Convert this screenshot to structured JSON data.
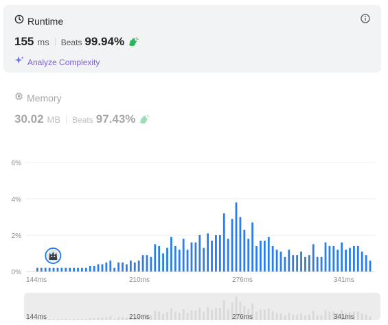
{
  "runtime": {
    "title": "Runtime",
    "value": "155",
    "unit": "ms",
    "beats_label": "Beats",
    "beats_value": "99.94%",
    "analyze_label": "Analyze Complexity"
  },
  "memory": {
    "title": "Memory",
    "value": "30.02",
    "unit": "MB",
    "beats_label": "Beats",
    "beats_value": "97.43%"
  },
  "colors": {
    "bar": "#2b7de9",
    "mini_bar": "#d9d9d9",
    "accent_purple": "#7b61d8",
    "clap_green": "#2db55d"
  },
  "icons": {
    "runtime": "clock-icon",
    "info": "info-icon",
    "analyze": "sparkle-icon",
    "memory": "chip-icon",
    "beats": "clap-icon",
    "marker": "avatar"
  },
  "chart_data": {
    "type": "bar",
    "ylabel": "",
    "xlabel": "",
    "y_ticks": [
      "0%",
      "2%",
      "4%",
      "6%"
    ],
    "ylim": [
      0,
      6
    ],
    "x_ticks": [
      "144ms",
      "210ms",
      "276ms",
      "341ms"
    ],
    "x_tick_positions": [
      144,
      210,
      276,
      341
    ],
    "x_start": 144,
    "x_step": 2.6,
    "values": [
      0.2,
      0.2,
      0.2,
      0.2,
      0.2,
      0.2,
      0.2,
      0.2,
      0.2,
      0.2,
      0.2,
      0.2,
      0.2,
      0.3,
      0.3,
      0.4,
      0.4,
      0.5,
      0.6,
      0.2,
      0.5,
      0.5,
      0.4,
      0.6,
      0.5,
      0.6,
      0.9,
      0.9,
      0.8,
      1.5,
      1.4,
      1.0,
      1.3,
      1.9,
      1.4,
      1.2,
      1.8,
      1.2,
      1.6,
      1.6,
      2.0,
      1.3,
      2.1,
      1.7,
      2.0,
      2.0,
      3.2,
      1.8,
      2.9,
      3.8,
      3.0,
      2.3,
      1.8,
      2.7,
      1.4,
      1.7,
      1.7,
      1.9,
      1.4,
      1.2,
      1.1,
      0.8,
      1.2,
      0.9,
      0.9,
      1.1,
      0.8,
      0.9,
      1.5,
      0.8,
      0.8,
      1.6,
      1.4,
      1.4,
      1.2,
      1.6,
      1.2,
      1.3,
      1.4,
      1.4,
      1.1,
      0.9,
      0.6
    ],
    "user_bin_index": 1,
    "user_value": "155 ms",
    "grid": true
  }
}
